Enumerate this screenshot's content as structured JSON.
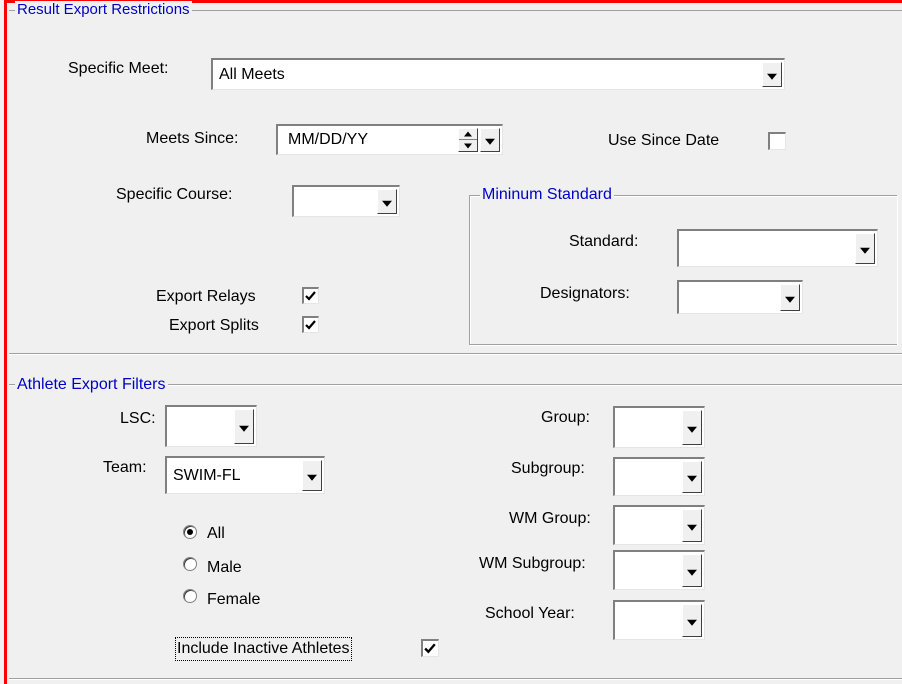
{
  "result_export": {
    "legend": "Result Export Restrictions",
    "specific_meet_label": "Specific Meet:",
    "specific_meet_value": "All Meets",
    "meets_since_label": "Meets Since:",
    "meets_since_value": "MM/DD/YY",
    "use_since_date_label": "Use Since Date",
    "use_since_date_checked": false,
    "specific_course_label": "Specific Course:",
    "specific_course_value": "",
    "export_relays_label": "Export Relays",
    "export_relays_checked": true,
    "export_splits_label": "Export Splits",
    "export_splits_checked": true,
    "minimum_standard": {
      "legend": "Mininum Standard",
      "standard_label": "Standard:",
      "standard_value": "",
      "designators_label": "Designators:",
      "designators_value": ""
    }
  },
  "athlete_filters": {
    "legend": "Athlete Export Filters",
    "lsc_label": "LSC:",
    "lsc_value": "",
    "team_label": "Team:",
    "team_value": "SWIM-FL",
    "gender_options": [
      "All",
      "Male",
      "Female"
    ],
    "gender_selected": "All",
    "include_inactive_label": "Include Inactive Athletes",
    "include_inactive_checked": true,
    "group_label": "Group:",
    "group_value": "",
    "subgroup_label": "Subgroup:",
    "subgroup_value": "",
    "wm_group_label": "WM Group:",
    "wm_group_value": "",
    "wm_subgroup_label": "WM Subgroup:",
    "wm_subgroup_value": "",
    "school_year_label": "School Year:",
    "school_year_value": ""
  },
  "colors": {
    "window_border": "#ff0000",
    "legend_text": "#0000c8",
    "background": "#f0f0f0"
  }
}
